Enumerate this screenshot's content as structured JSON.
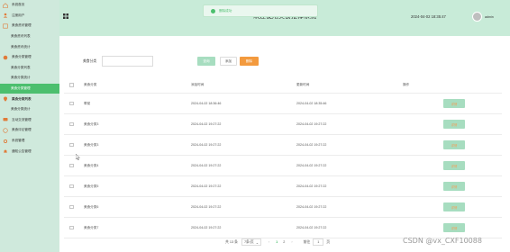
{
  "app": {
    "title": "欢迎使用美食推荐系统",
    "datetime": "2024-04-02 18:35:47",
    "username": "admin"
  },
  "toast": {
    "text": "删除成功"
  },
  "sidebar": {
    "items": [
      {
        "label": "系统首页",
        "icon": "home-icon",
        "sub": false
      },
      {
        "label": "注册用户",
        "icon": "user-icon",
        "sub": false
      },
      {
        "label": "美食资讯管理",
        "icon": "news-icon",
        "sub": false
      },
      {
        "label": "美食资讯列表",
        "icon": "",
        "sub": true
      },
      {
        "label": "美食资讯统计",
        "icon": "",
        "sub": true
      },
      {
        "label": "美食分类管理",
        "icon": "category-icon",
        "sub": false
      },
      {
        "label": "美食分类列表",
        "icon": "",
        "sub": true
      },
      {
        "label": "美食分类统计",
        "icon": "",
        "sub": true
      },
      {
        "label": "美食分类管理",
        "icon": "",
        "sub": true,
        "active": true
      },
      {
        "label": "美食分类列表",
        "icon": "pin-icon",
        "sub": false,
        "bold": true
      },
      {
        "label": "美食分类统计",
        "icon": "",
        "sub": true
      },
      {
        "label": "互动交流管理",
        "icon": "chat-icon",
        "sub": false
      },
      {
        "label": "美食评论管理",
        "icon": "comment-icon",
        "sub": false
      },
      {
        "label": "系统管理",
        "icon": "gear-icon",
        "sub": false
      },
      {
        "label": "通知公告管理",
        "icon": "bell-icon",
        "sub": false
      }
    ]
  },
  "search": {
    "label": "美食分类",
    "placeholder": "",
    "value": "",
    "search_btn": "查询",
    "add_btn": "添加",
    "delete_btn": "删除"
  },
  "table": {
    "headers": {
      "name": "美食分类",
      "created": "添加时间",
      "updated": "更新时间",
      "op": "操作"
    },
    "op_btn": "详情",
    "rows": [
      {
        "name": "荤菜",
        "created": "2024-04-02 18:36:46",
        "updated": "2024-04-02 18:35:46"
      },
      {
        "name": "美食分类3",
        "created": "2024-04-02 19:27:22",
        "updated": "2024-04-02 19:27:22"
      },
      {
        "name": "美食分类3",
        "created": "2024-04-02 19:27:22",
        "updated": "2024-04-02 19:27:22"
      },
      {
        "name": "美食分类4",
        "created": "2024-04-02 19:27:22",
        "updated": "2024-04-02 19:27:22"
      },
      {
        "name": "美食分类5",
        "created": "2024-04-02 19:27:22",
        "updated": "2024-04-02 19:27:22"
      },
      {
        "name": "美食分类6",
        "created": "2024-04-02 19:27:22",
        "updated": "2024-04-02 19:27:22"
      },
      {
        "name": "美食分类7",
        "created": "2024-04-02 19:27:22",
        "updated": "2024-04-02 19:27:22"
      }
    ]
  },
  "pager": {
    "total": "共 13 条",
    "page_size": "7条/页",
    "pages": [
      "1",
      "2"
    ],
    "current": "1",
    "goto_label": "前往",
    "goto_value": "1",
    "page_unit": "页"
  },
  "watermark": "CSDN @vx_CXF10088",
  "colors": {
    "sidebar_bg": "#cfe9dc",
    "header_bg": "#c8ebd8",
    "accent": "#4cbf6e",
    "delete": "#f39a3e"
  }
}
